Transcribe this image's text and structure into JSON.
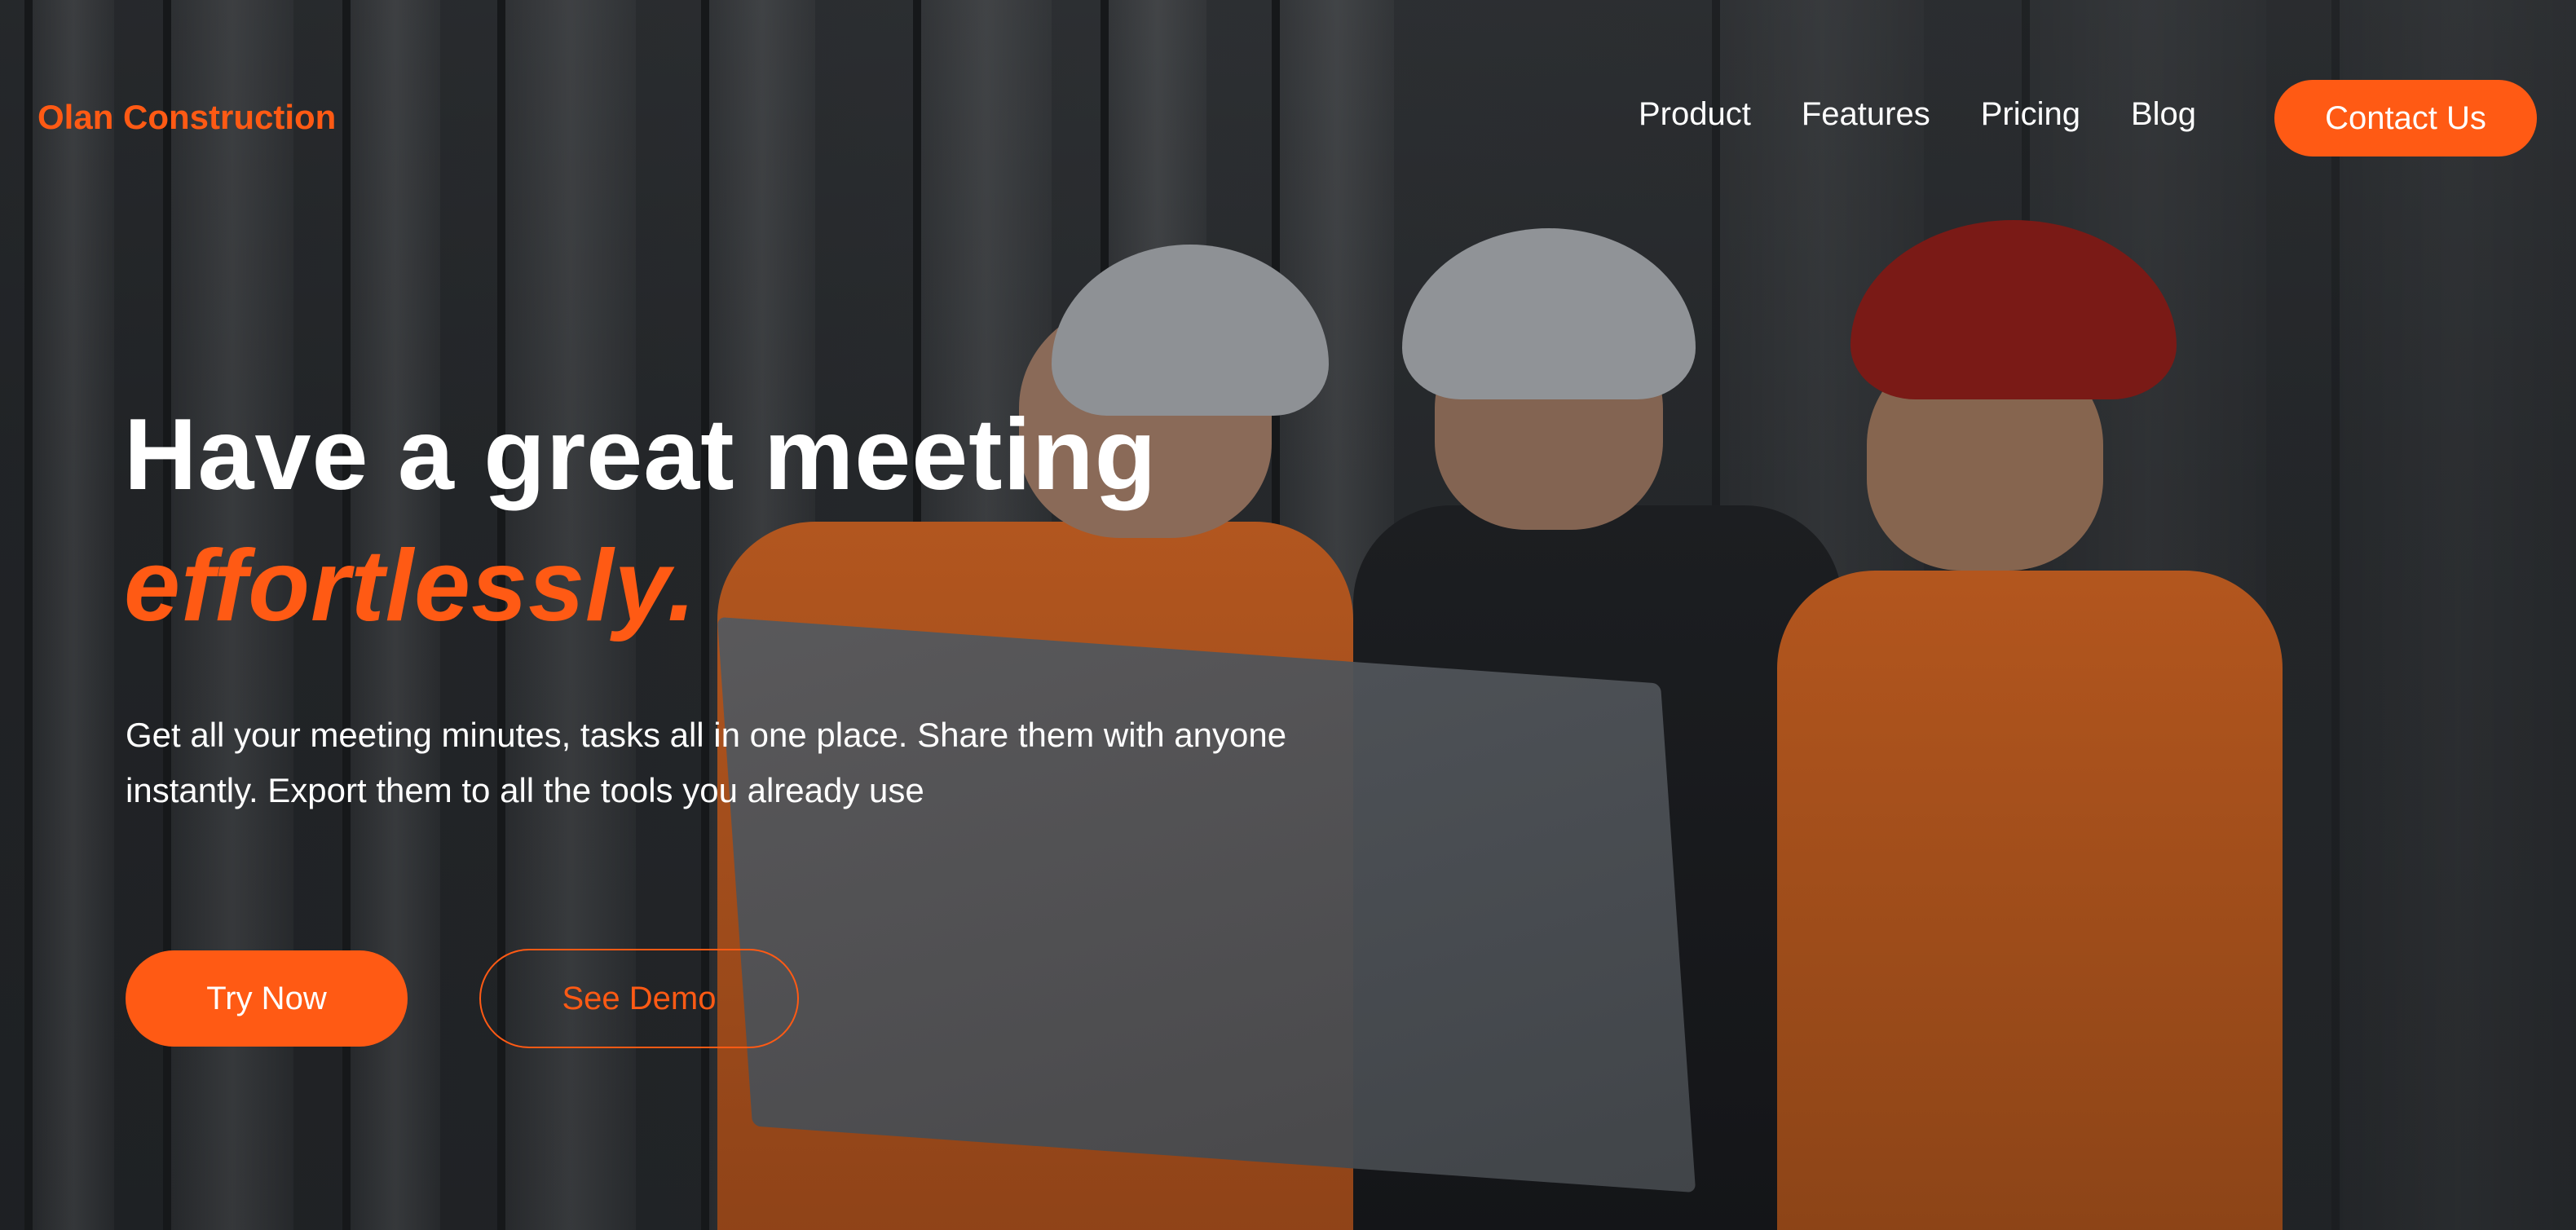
{
  "brand": {
    "name": "Olan Construction"
  },
  "nav": {
    "links": [
      {
        "label": "Product"
      },
      {
        "label": "Features"
      },
      {
        "label": "Pricing"
      },
      {
        "label": "Blog"
      }
    ],
    "cta_label": "Contact Us"
  },
  "hero": {
    "title_line1": "Have a great meeting",
    "title_line2": "effortlessly.",
    "subtitle": "Get all your meeting minutes, tasks all in one place. Share them with anyone instantly. Export them to all the tools you already use",
    "primary_button": "Try Now",
    "secondary_button": "See Demo"
  },
  "colors": {
    "accent": "#ff5a14",
    "text": "#ffffff",
    "background": "#2b2e31"
  }
}
